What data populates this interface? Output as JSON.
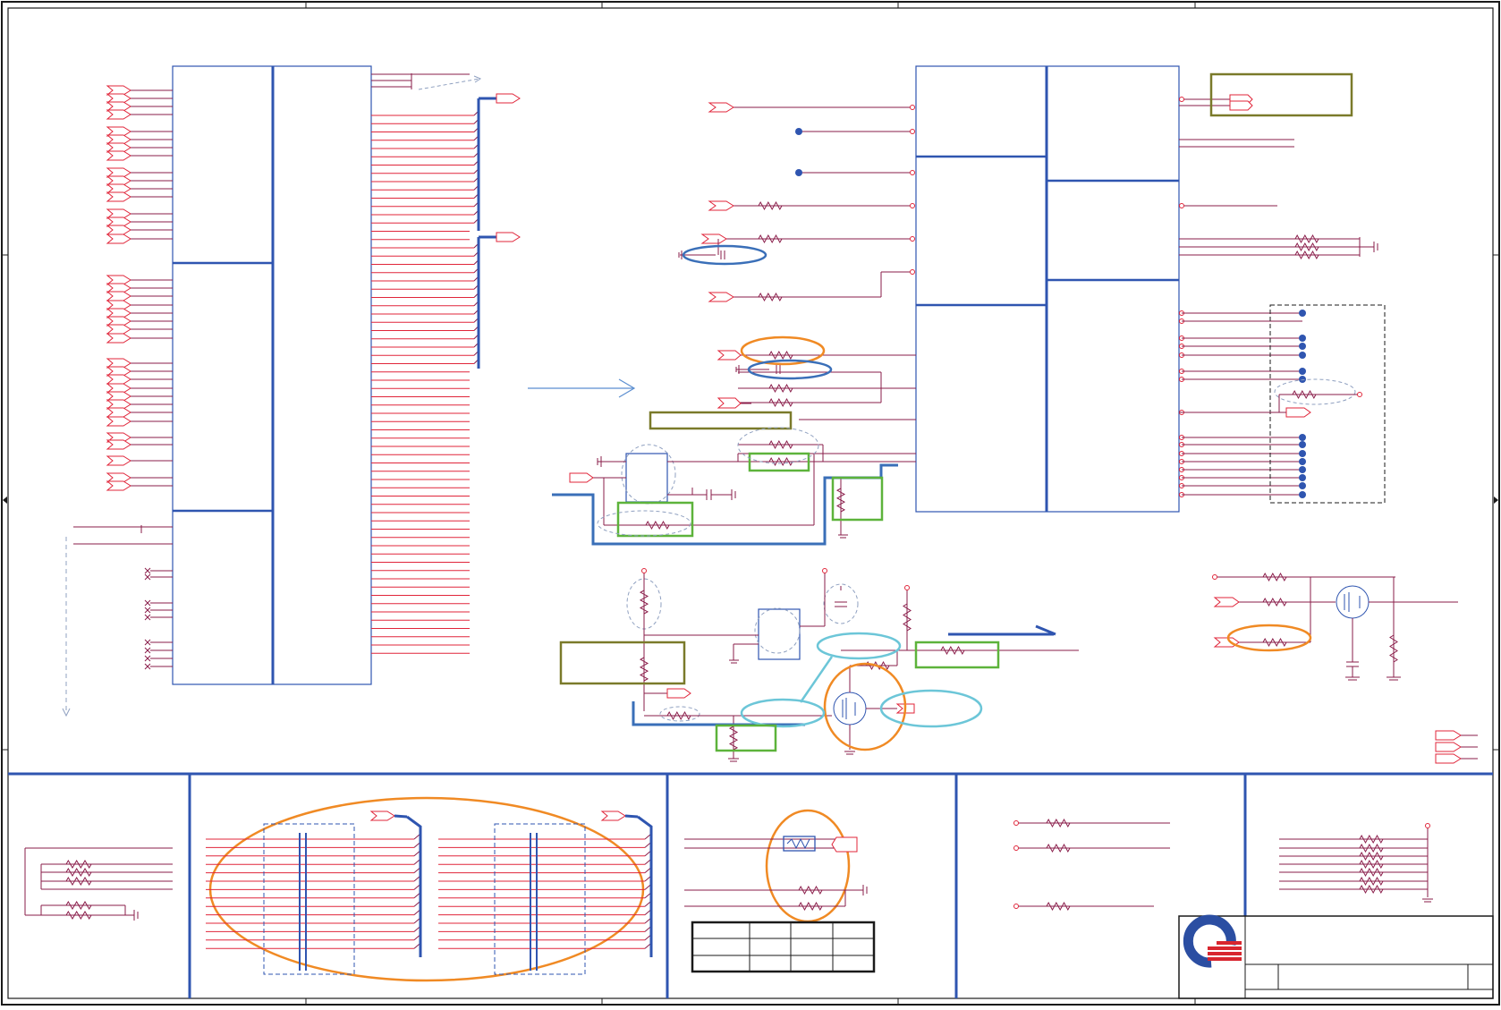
{
  "colors": {
    "border": "#1a1a1a",
    "block": "#2f55b0",
    "wire_red": "#e0253a",
    "wire_maroon": "#8a1d4a",
    "bus": "#2f55b0",
    "ring_orange": "#f08a24",
    "ring_blue": "#3a6fb8",
    "ring_cyan": "#6cc6d8",
    "box_green": "#5db33b",
    "box_olive": "#7a7a2a",
    "dashed_gray": "#8fa0c0",
    "logo_blue": "#2b4ea2",
    "logo_red": "#d8262f"
  },
  "legend": [],
  "title_block": {}
}
